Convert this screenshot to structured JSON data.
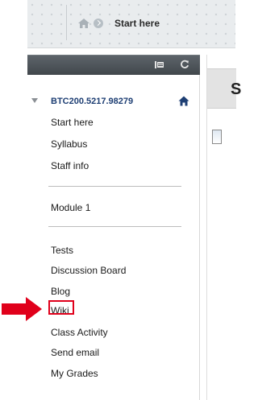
{
  "breadcrumb": {
    "current_label": "Start here"
  },
  "course_menu": {
    "course_title": "BTC200.5217.98279",
    "items_group1": [
      "Start here",
      "Syllabus",
      "Staff info"
    ],
    "items_group2": [
      "Module 1"
    ],
    "items_group3": [
      "Tests",
      "Discussion Board",
      "Blog",
      "Wiki",
      "Class Activity",
      "Send email",
      "My Grades"
    ]
  },
  "content": {
    "title_visible_char": "S"
  },
  "colors": {
    "accent_red": "#e0001b",
    "course_title_blue": "#1d3e73",
    "header_dark": "#4a5055"
  },
  "icons": [
    "home-icon",
    "chevron-right-icon",
    "folder-icon",
    "refresh-icon",
    "collapse-triangle-icon",
    "home-blue-icon",
    "red-arrow-icon"
  ]
}
